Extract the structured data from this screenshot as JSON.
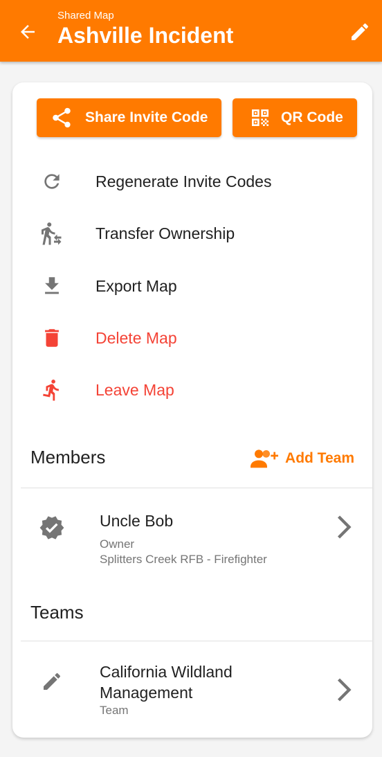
{
  "appbar": {
    "subtitle": "Shared Map",
    "title": "Ashville Incident",
    "back_icon": "arrow-left-icon",
    "edit_icon": "pencil-icon"
  },
  "buttons": {
    "share_label": "Share Invite Code",
    "share_icon": "share-icon",
    "qr_label": "QR Code",
    "qr_icon": "qr-code-icon"
  },
  "actions": [
    {
      "label": "Regenerate Invite Codes",
      "icon": "refresh-icon",
      "danger": false
    },
    {
      "label": "Transfer Ownership",
      "icon": "walk-transfer-icon",
      "danger": false
    },
    {
      "label": "Export Map",
      "icon": "download-icon",
      "danger": false
    },
    {
      "label": "Delete Map",
      "icon": "trash-icon",
      "danger": true
    },
    {
      "label": "Leave Map",
      "icon": "run-icon",
      "danger": true
    }
  ],
  "members": {
    "title": "Members",
    "add_team_label": "Add Team",
    "add_team_icon": "add-group-icon",
    "items": [
      {
        "name": "Uncle Bob",
        "role": "Owner",
        "detail": "Splitters Creek RFB - Firefighter",
        "icon": "verified-badge-icon"
      }
    ]
  },
  "teams": {
    "title": "Teams",
    "items": [
      {
        "name": "California Wildland Management",
        "type": "Team",
        "icon": "pencil-icon"
      }
    ]
  },
  "colors": {
    "accent": "#ff7a00",
    "danger": "#f44336",
    "icon_gray": "#757575"
  }
}
